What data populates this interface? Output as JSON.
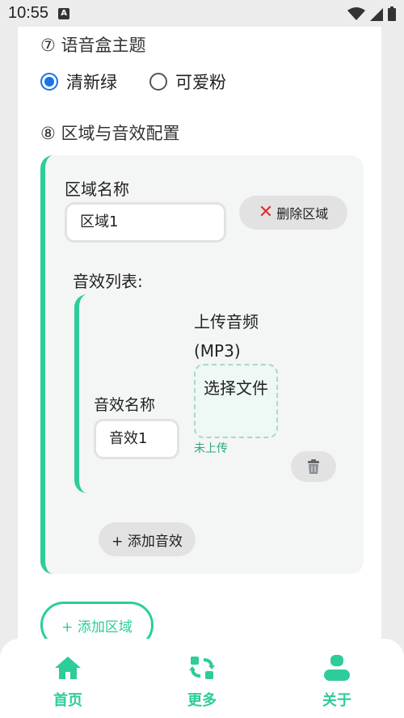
{
  "status_bar": {
    "time": "10:55",
    "notification_icon": "A"
  },
  "theme_section": {
    "title": "⑦ 语音盒主题",
    "options": [
      {
        "label": "清新绿",
        "checked": true
      },
      {
        "label": "可爱粉",
        "checked": false
      }
    ]
  },
  "region_section": {
    "title": "⑧ 区域与音效配置",
    "region_name_label": "区域名称",
    "region_name_value": "区域1",
    "delete_region_label": "删除区域",
    "sfx_list_label": "音效列表:",
    "sfx": {
      "name_label": "音效名称",
      "name_value": "音效1",
      "upload_label": "上传音频(MP3)",
      "file_button_label": "选择文件",
      "file_status": "未上传"
    },
    "add_sfx_label": "+ 添加音效",
    "add_region_label": "+ 添加区域"
  },
  "bottom_nav": {
    "items": [
      {
        "label": "首页",
        "icon": "home-icon"
      },
      {
        "label": "更多",
        "icon": "refresh-icon"
      },
      {
        "label": "关于",
        "icon": "person-icon"
      }
    ]
  },
  "colors": {
    "accent": "#2ecc9a",
    "radio_checked": "#1a73e8",
    "delete": "#e03030"
  }
}
